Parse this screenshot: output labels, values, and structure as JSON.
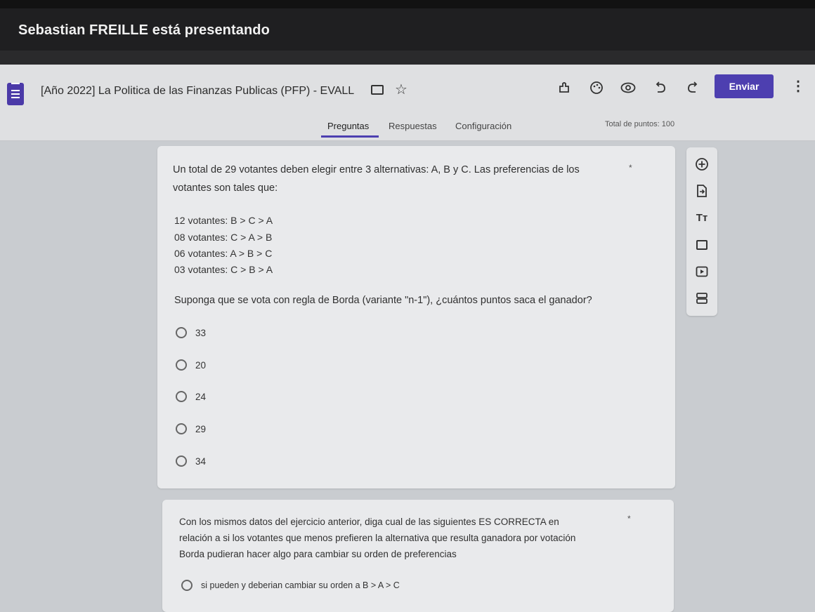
{
  "presenter": {
    "text": "Sebastian FREILLE está presentando"
  },
  "header": {
    "title": "[Año 2022] La Politica de las Finanzas Publicas (PFP) - EVALL",
    "send_label": "Enviar",
    "icons": [
      "folder-icon",
      "star-icon",
      "addon-icon",
      "palette-icon",
      "preview-icon",
      "undo-icon",
      "redo-icon",
      "more-vert-icon"
    ]
  },
  "tabs": {
    "questions": "Preguntas",
    "responses": "Respuestas",
    "settings": "Configuración"
  },
  "total_points": "Total de puntos: 100",
  "question1": {
    "intro_line1": "Un total de 29 votantes deben elegir entre 3 alternativas: A, B y C. Las preferencias de los",
    "intro_line2": "votantes son tales que:",
    "prefs": [
      "12 votantes: B > C > A",
      "08 votantes: C > A > B",
      "06 votantes: A > B > C",
      "03 votantes: C > B > A"
    ],
    "prompt": "Suponga que se vota con regla de Borda (variante \"n-1\"), ¿cuántos puntos saca el ganador?",
    "options": [
      "33",
      "20",
      "24",
      "29",
      "34"
    ],
    "required_mark": "*"
  },
  "question2": {
    "line1": "Con los mismos datos del ejercicio anterior, diga cual de las siguientes ES CORRECTA en",
    "line2": "relación a si los votantes que menos prefieren la alternativa que resulta ganadora por votación",
    "line3": "Borda pudieran hacer algo para cambiar su orden de preferencias",
    "option1": "si pueden y deberian cambiar su orden a B > A > C",
    "required_mark": "*"
  },
  "side_toolbar": {
    "icons": [
      "add-question-icon",
      "import-question-icon",
      "title-text-icon",
      "image-icon",
      "video-icon",
      "section-icon"
    ],
    "title_glyph": "Tт"
  },
  "colors": {
    "accent": "#4d3fb0",
    "presenter_bg": "#1f1f21"
  }
}
